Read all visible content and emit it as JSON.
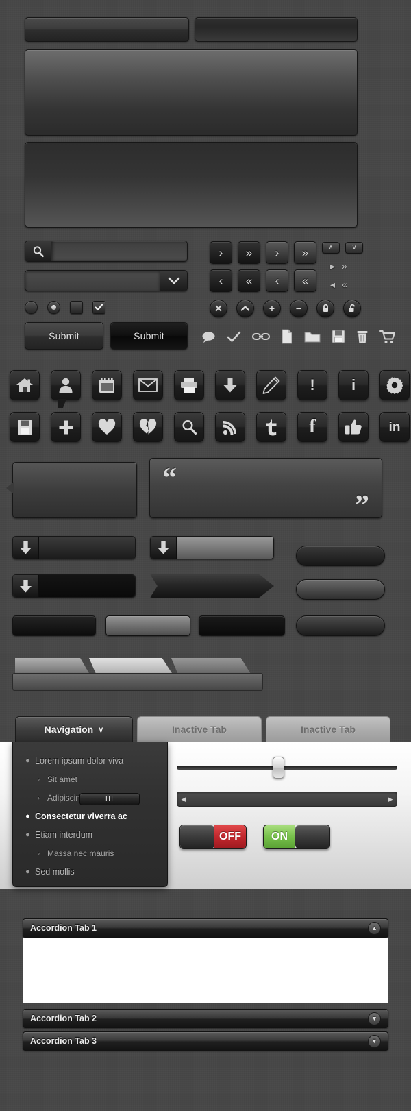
{
  "search": {
    "value": "",
    "placeholder": "",
    "icon": "search-icon"
  },
  "select": {
    "value": "",
    "arrow_icon": "chevron-down-icon"
  },
  "buttons": {
    "submit_primary": "Submit",
    "submit_secondary": "Submit"
  },
  "nav_buttons": {
    "next": "›",
    "fast_forward": "»",
    "prev": "‹",
    "rewind": "«",
    "up": "∧",
    "down": "∨",
    "play_right": "▸",
    "skip_right": "➤",
    "play_left": "◂",
    "skip_left": "⯇"
  },
  "round_buttons": [
    {
      "name": "close-button",
      "glyph": "✕"
    },
    {
      "name": "collapse-button",
      "glyph": "▲"
    },
    {
      "name": "add-button",
      "glyph": "+"
    },
    {
      "name": "remove-button",
      "glyph": "−"
    },
    {
      "name": "lock-closed-button",
      "glyph": "■"
    },
    {
      "name": "lock-open-button",
      "glyph": "■"
    }
  ],
  "flat_icons": [
    {
      "name": "comment-icon"
    },
    {
      "name": "check-icon"
    },
    {
      "name": "link-icon"
    },
    {
      "name": "file-icon"
    },
    {
      "name": "folder-icon"
    },
    {
      "name": "save-icon"
    },
    {
      "name": "trash-icon"
    },
    {
      "name": "cart-icon"
    }
  ],
  "icon_row_1": [
    {
      "name": "home-icon"
    },
    {
      "name": "user-icon"
    },
    {
      "name": "calendar-icon"
    },
    {
      "name": "mail-icon"
    },
    {
      "name": "printer-icon"
    },
    {
      "name": "download-icon"
    },
    {
      "name": "pencil-icon"
    },
    {
      "name": "alert-icon",
      "label": "!"
    },
    {
      "name": "info-icon",
      "label": "i"
    },
    {
      "name": "gear-icon"
    }
  ],
  "icon_row_2": [
    {
      "name": "floppy-save-icon"
    },
    {
      "name": "plus-icon",
      "label": "+"
    },
    {
      "name": "heart-icon"
    },
    {
      "name": "broken-heart-icon"
    },
    {
      "name": "search-icon"
    },
    {
      "name": "rss-icon"
    },
    {
      "name": "twitter-icon"
    },
    {
      "name": "facebook-icon",
      "label": "f"
    },
    {
      "name": "thumbs-up-icon"
    },
    {
      "name": "linkedin-icon",
      "label": "in"
    }
  ],
  "quote": {
    "open_mark": "“",
    "close_mark": "”"
  },
  "tabs": {
    "active": {
      "label": "Navigation",
      "caret": "∨"
    },
    "inactive_1": "Inactive Tab",
    "inactive_2": "Inactive Tab"
  },
  "menu": {
    "items": [
      {
        "label": "Lorem ipsum dolor viva",
        "level": 0,
        "current": false,
        "bullet": "●"
      },
      {
        "label": "Sit amet",
        "level": 1,
        "current": false,
        "bullet": "›"
      },
      {
        "label": "Adipiscing",
        "level": 1,
        "current": false,
        "bullet": "›"
      },
      {
        "label": "Consectetur viverra ac",
        "level": 0,
        "current": true,
        "bullet": "●"
      },
      {
        "label": "Etiam interdum",
        "level": 0,
        "current": false,
        "bullet": "●"
      },
      {
        "label": "Massa nec mauris",
        "level": 1,
        "current": false,
        "bullet": "›"
      },
      {
        "label": "Sed mollis",
        "level": 0,
        "current": false,
        "bullet": "●"
      }
    ]
  },
  "slider": {
    "value_percent": 44
  },
  "scrollbar": {
    "left_arrow": "◀",
    "right_arrow": "▶",
    "grip": "III",
    "thumb_percent": 27
  },
  "toggles": {
    "off": {
      "label": "OFF",
      "state": "off",
      "color": "#c1272d"
    },
    "on": {
      "label": "ON",
      "state": "on",
      "color": "#76c04a"
    }
  },
  "accordion": {
    "items": [
      {
        "title": "Accordion Tab 1",
        "expanded": true,
        "chevron": "▲"
      },
      {
        "title": "Accordion Tab 2",
        "expanded": false,
        "chevron": "▼"
      },
      {
        "title": "Accordion Tab 3",
        "expanded": false,
        "chevron": "▼"
      }
    ]
  },
  "theme": {
    "background": "#474747",
    "accent_red": "#c1272d",
    "accent_green": "#76c04a",
    "panel_dark": "#2b2b2b",
    "text_light": "#e4e4e4"
  }
}
